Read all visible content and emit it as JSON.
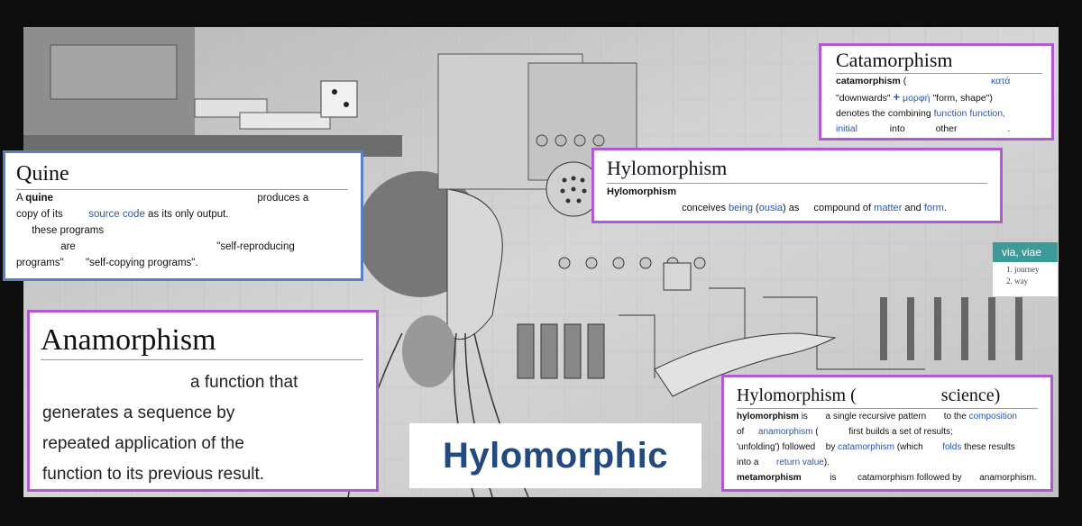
{
  "catamorphism": {
    "title": "Catamorphism",
    "term": "catamorphism",
    "open_paren": "(",
    "greek1": "κατά",
    "q1": "\"downwards\"",
    "plus": "+",
    "greek2": "μορφή",
    "q2": "\"form, shape\")",
    "t1": "denotes the",
    "t2": "combining",
    "l1": "function",
    "l2": "function,",
    "l3": "initial",
    "t3": "into",
    "t4": "other",
    "t5": "."
  },
  "hylomorphism_top": {
    "title": "Hylomorphism",
    "term": "Hylomorphism",
    "t1": "conceives",
    "l1": "being",
    "paren_open": "(",
    "l2": "ousia",
    "paren_close": ")",
    "t2": "as",
    "t3": "compound of",
    "l3": "matter",
    "t4": "and",
    "l4": "form",
    "t5": "."
  },
  "quine": {
    "title": "Quine",
    "t_a": "A",
    "term": "quine",
    "t1": "produces a",
    "t2": "copy of its",
    "l1": "source code",
    "t3": "as its only output.",
    "t4": "these programs",
    "t5": "are",
    "t6": "\"self-reproducing",
    "t7": "programs\"",
    "t8": "\"self-copying programs\"."
  },
  "via": {
    "header": "via, viae",
    "items": [
      "journey",
      "way"
    ]
  },
  "anamorphism": {
    "title": "Anamorphism",
    "line1": "a function that",
    "line2": "generates a sequence by",
    "line3": "repeated application of the",
    "line4": "function to its previous result."
  },
  "hylomorphic": {
    "label": "Hylomorphic"
  },
  "hylomorphism_bottom": {
    "title_a": "Hylomorphism (",
    "title_b": "science)",
    "r1_term": "hylomorphism",
    "r1_t1": "is",
    "r1_t2": "a single recursive pattern",
    "r1_t3": "to the",
    "r1_l1": "composition",
    "r2_t1": "of",
    "r2_l1": "anamorphism",
    "r2_t2": "(",
    "r2_t3": "first builds a set of results;",
    "r3_t1": "'unfolding')",
    "r3_t2": "followed",
    "r3_t3": "by",
    "r3_l1": "catamorphism",
    "r3_t4": "(which",
    "r3_l2": "folds",
    "r3_t5": "these results",
    "r4_t1": "into a",
    "r4_l1": "return value",
    "r4_t2": ").",
    "r5_term": "metamorphism",
    "r5_t1": "is",
    "r5_t2": "catamorphism followed by",
    "r5_t3": "anamorphism."
  }
}
